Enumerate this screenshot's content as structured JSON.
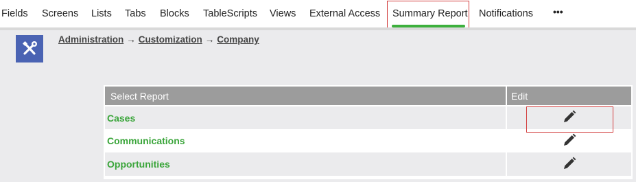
{
  "tabs": [
    {
      "label": "Fields"
    },
    {
      "label": "Screens"
    },
    {
      "label": "Lists"
    },
    {
      "label": "Tabs"
    },
    {
      "label": "Blocks"
    },
    {
      "label": "TableScripts"
    },
    {
      "label": "Views"
    },
    {
      "label": "External Access"
    },
    {
      "label": "Summary Report"
    },
    {
      "label": "Notifications"
    }
  ],
  "more_label": "•••",
  "active_tab": "Summary Report",
  "breadcrumb": {
    "items": [
      "Administration",
      "Customization",
      "Company"
    ],
    "separator": "→"
  },
  "logo_icon": "tools-icon",
  "table": {
    "headers": {
      "report": "Select Report",
      "edit": "Edit"
    },
    "rows": [
      {
        "name": "Cases"
      },
      {
        "name": "Communications"
      },
      {
        "name": "Opportunities"
      }
    ]
  },
  "colors": {
    "accent_green": "#3db03d",
    "link_green": "#3aa53a",
    "header_gray": "#9c9c9c",
    "logo_blue": "#4a63b3",
    "highlight_red": "#d23b3b"
  }
}
